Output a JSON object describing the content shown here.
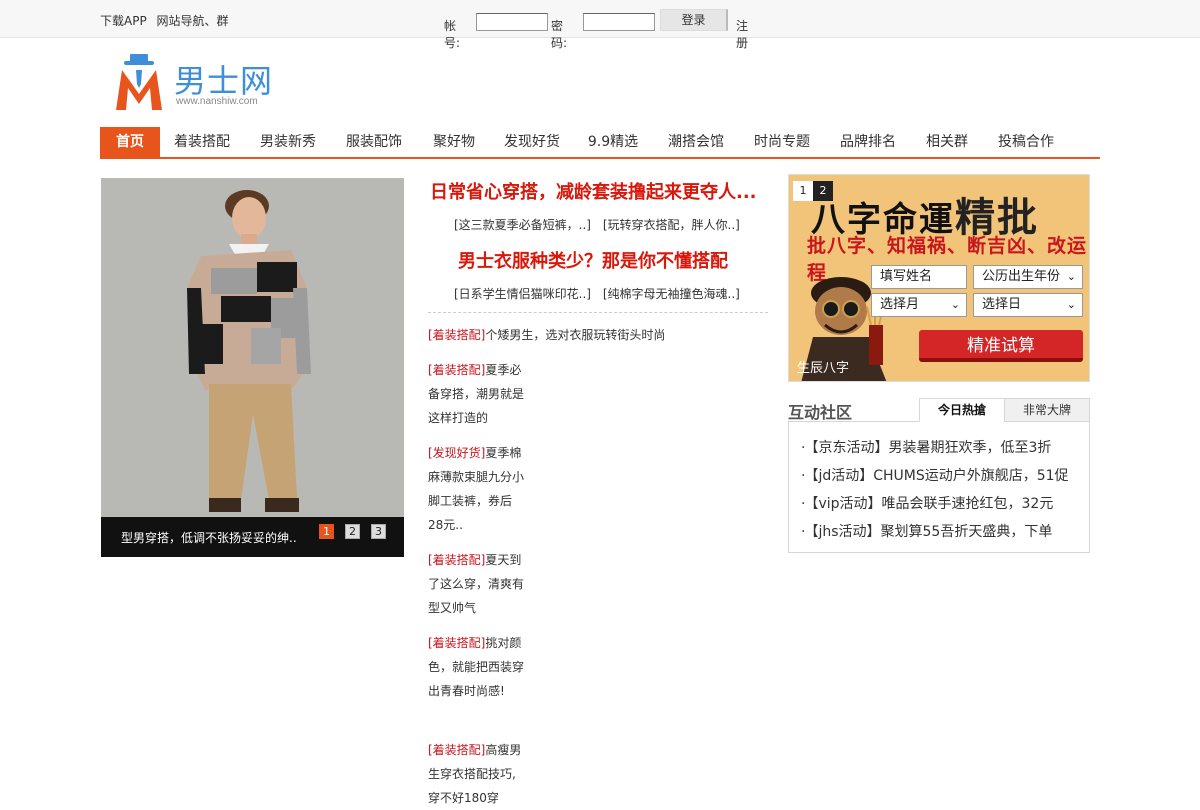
{
  "topbar": {
    "links": [
      "下载APP",
      "网站导航",
      "、群"
    ],
    "account_label": "帐号:",
    "password_label": "密码:",
    "login_button": "登录",
    "register_link": "注册"
  },
  "logo": {
    "name": "男士网",
    "url_text": "www.nanshiw.com"
  },
  "nav": {
    "items": [
      "首页",
      "着装搭配",
      "男装新秀",
      "服装配饰",
      "聚好物",
      "发现好货",
      "9.9精选",
      "潮搭会馆",
      "时尚专题",
      "品牌排名",
      "相关群",
      "投稿合作"
    ]
  },
  "slideshow": {
    "caption": "型男穿搭，低调不张扬妥妥的绅..",
    "pages": [
      "1",
      "2",
      "3"
    ],
    "active_page": "1"
  },
  "middle": {
    "headline1": "日常省心穿搭，减龄套装撸起来更夺人...",
    "sublinks1": [
      "[这三款夏季必备短裤，..]",
      "[玩转穿衣搭配，胖人你..]"
    ],
    "headline2": "男士衣服种类少？那是你不懂搭配",
    "sublinks2": [
      "[日系学生情侣猫咪印花..]",
      "[纯棉字母无袖撞色海魂..]"
    ],
    "list": [
      {
        "tag": "[着装搭配]",
        "text": "个矮男生，选对衣服玩转街头时尚"
      },
      {
        "tag": "[着装搭配]",
        "text": "夏季必备穿搭，潮男就是这样打造的"
      },
      {
        "tag": "[发现好货]",
        "text": "夏季棉麻薄款束腿九分小脚工装裤，券后28元.."
      },
      {
        "tag": "[着装搭配]",
        "text": "夏天到了这么穿，清爽有型又帅气"
      },
      {
        "tag": "[着装搭配]",
        "text": "挑对颜色，就能把西装穿出青春时尚感!"
      },
      {
        "tag": "[着装搭配]",
        "text": "高瘦男生穿衣搭配技巧,穿不好180穿"
      }
    ]
  },
  "ad": {
    "pages": [
      "1",
      "2"
    ],
    "title_small": "八字命運",
    "title_big": "精批",
    "subtitle": "批八字、知福祸、断吉凶、改运程",
    "field_name": "填写姓名",
    "field_year": "公历出生年份",
    "field_month": "选择月",
    "field_day": "选择日",
    "button": "精准试算",
    "footer": "生辰八字"
  },
  "community": {
    "title": "互动社区",
    "tabs": [
      "今日热搶",
      "非常大牌"
    ],
    "items": [
      "【京东活动】男装暑期狂欢季，低至3折",
      "【jd活动】CHUMS运动户外旗舰店，51促",
      "【vip活动】唯品会联手速抢红包，32元",
      "【jhs活动】聚划算55吾折天盛典，下单"
    ]
  },
  "colors": {
    "accent": "#e8551c",
    "headline_red": "#d9180b",
    "tag_red": "#c8161d",
    "logo_blue": "#3f8fd8"
  }
}
